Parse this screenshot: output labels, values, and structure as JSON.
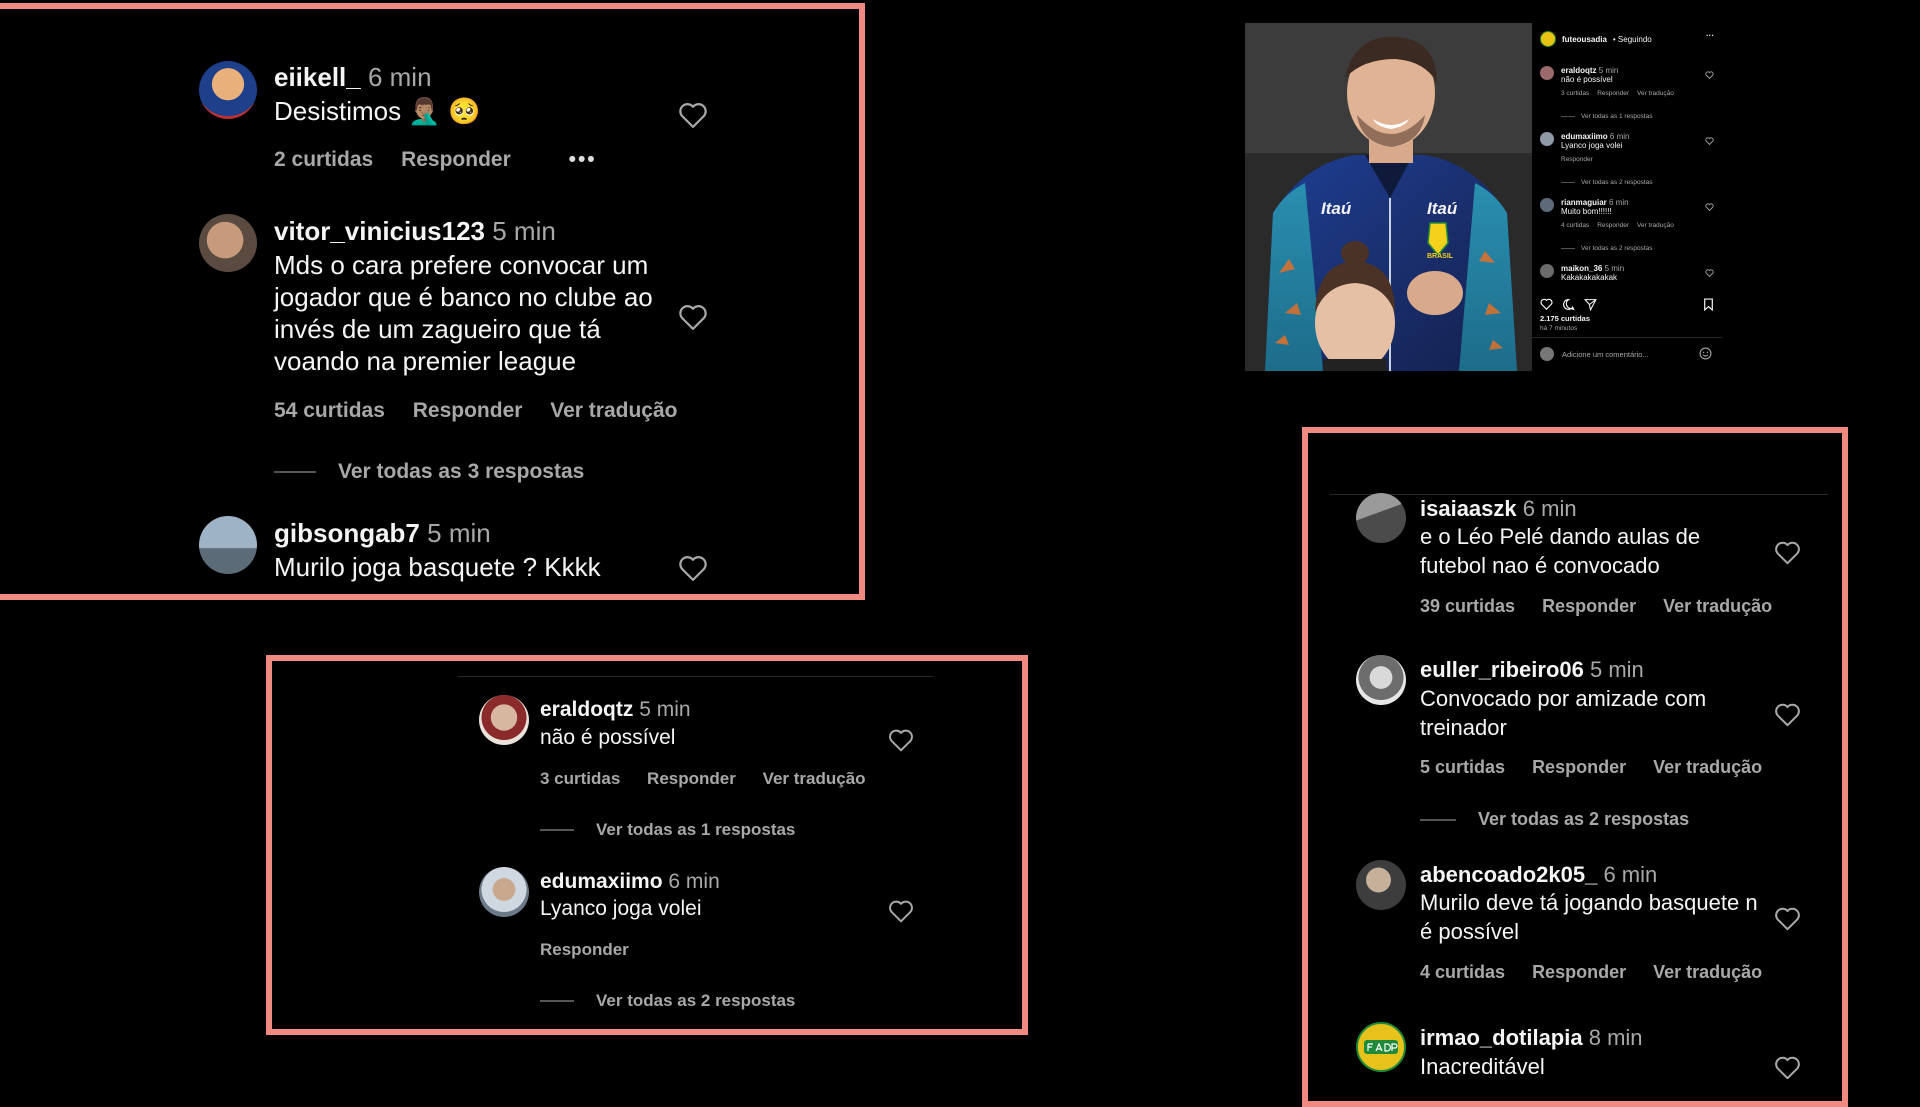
{
  "colors": {
    "background": "#000000",
    "frame": "#f08a80",
    "text_primary": "#f5f5f5",
    "text_secondary": "#a8a8a8"
  },
  "panel_a": {
    "comments": [
      {
        "username": "eiikell_",
        "time": "6 min",
        "text": "Desistimos 🤦🏽‍♂️ 🥺",
        "likes": "2 curtidas",
        "reply": "Responder",
        "more": "•••"
      },
      {
        "username": "vitor_vinicius123",
        "time": "5 min",
        "text_lines": [
          "Mds o cara prefere convocar um",
          "jogador que é banco no clube ao",
          "invés de um zagueiro que tá",
          "voando na premier league"
        ],
        "likes": "54 curtidas",
        "reply": "Responder",
        "translate": "Ver tradução",
        "view_replies": "Ver todas as 3 respostas"
      },
      {
        "username": "gibsongab7",
        "time": "5 min",
        "text": "Murilo joga basquete ? Kkkk"
      }
    ]
  },
  "panel_b": {
    "comments": [
      {
        "username": "eraldoqtz",
        "time": "5 min",
        "text": "não é possível",
        "likes": "3 curtidas",
        "reply": "Responder",
        "translate": "Ver tradução",
        "view_replies": "Ver todas as 1 respostas"
      },
      {
        "username": "edumaxiimo",
        "time": "6 min",
        "text": "Lyanco joga volei",
        "reply": "Responder",
        "view_replies": "Ver todas as 2 respostas"
      }
    ]
  },
  "panel_c": {
    "comments": [
      {
        "username": "isaiaaszk",
        "time": "6 min",
        "text_lines": [
          "e o Léo Pelé dando aulas de",
          "futebol nao é convocado"
        ],
        "likes": "39 curtidas",
        "reply": "Responder",
        "translate": "Ver tradução"
      },
      {
        "username": "euller_ribeiro06",
        "time": "5 min",
        "text_lines": [
          "Convocado por amizade com",
          "treinador"
        ],
        "likes": "5 curtidas",
        "reply": "Responder",
        "translate": "Ver tradução",
        "view_replies": "Ver todas as 2 respostas"
      },
      {
        "username": "abencoado2k05_",
        "time": "6 min",
        "text_lines": [
          "Murilo deve tá jogando basquete n",
          "é possível"
        ],
        "likes": "4 curtidas",
        "reply": "Responder",
        "translate": "Ver tradução"
      },
      {
        "username": "irmao_dotilapia",
        "time": "8 min",
        "text": "Inacreditável"
      }
    ]
  },
  "mini_post": {
    "photo": {
      "sponsor_left": "Itaú",
      "sponsor_right": "Itaú",
      "badge_text": "BRASIL"
    },
    "account": "futeousadia",
    "following": "• Seguindo",
    "more": "···",
    "comments": [
      {
        "username": "eraldoqtz",
        "time": "5 min",
        "text": "não é possível",
        "likes": "3 curtidas",
        "reply": "Responder",
        "translate": "Ver tradução",
        "view_replies": "Ver todas as 1 respostas"
      },
      {
        "username": "edumaxiimo",
        "time": "6 min",
        "text": "Lyanco joga volei",
        "reply": "Responder",
        "view_replies": "Ver todas as 2 respostas"
      },
      {
        "username": "rianmaguiar",
        "time": "6 min",
        "text": "Muito bom!!!!!!",
        "likes": "4 curtidas",
        "reply": "Responder",
        "translate": "Ver tradução",
        "view_replies": "Ver todas as 2 respostas"
      },
      {
        "username": "maikon_36",
        "time": "5 min",
        "text": "Kakakakakakak"
      }
    ],
    "likes_total": "2.175 curtidas",
    "posted_ago": "há 7 minutos",
    "add_comment_placeholder": "Adicione um comentário..."
  }
}
